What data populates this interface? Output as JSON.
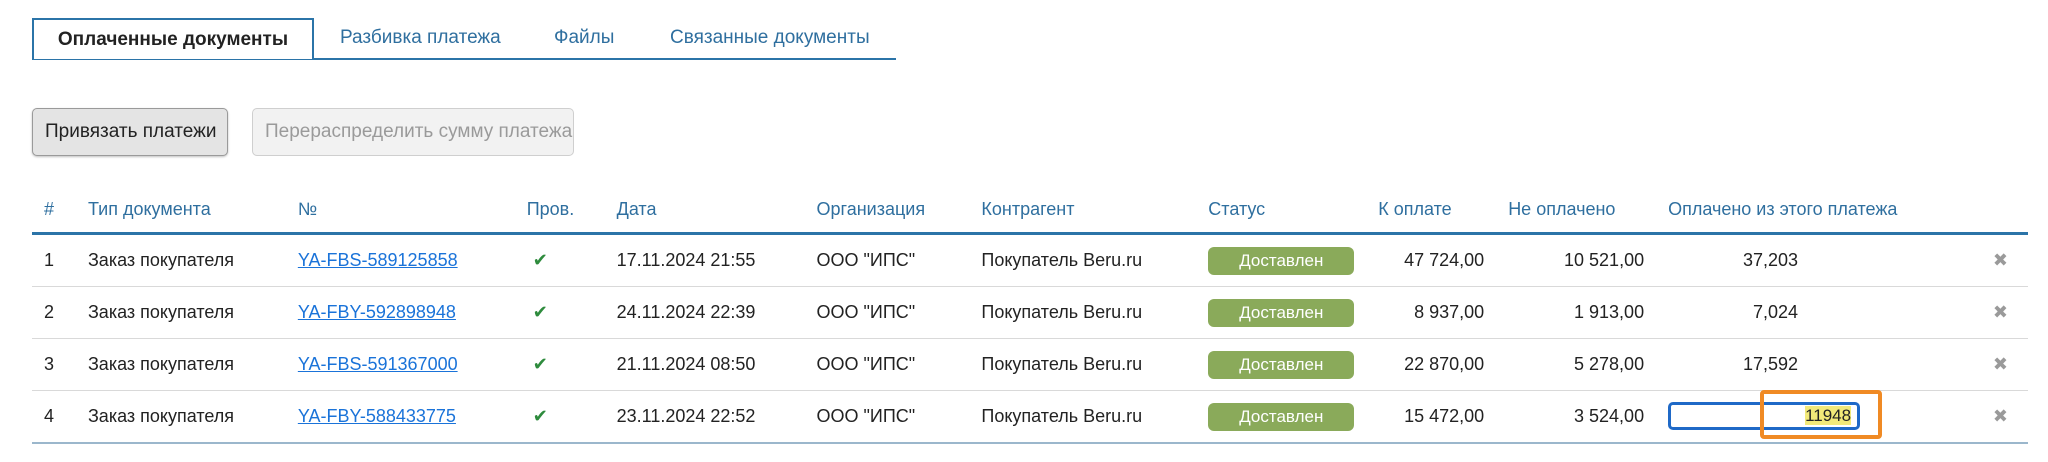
{
  "tabs": [
    {
      "label": "Оплаченные документы",
      "active": true
    },
    {
      "label": "Разбивка платежа",
      "active": false
    },
    {
      "label": "Файлы",
      "active": false
    },
    {
      "label": "Связанные документы",
      "active": false
    }
  ],
  "buttons": {
    "bind_payments": "Привязать платежи",
    "redistribute": "Перераспределить сумму платежа"
  },
  "table": {
    "headers": [
      "#",
      "Тип документа",
      "№",
      "Пров.",
      "Дата",
      "Организация",
      "Контрагент",
      "Статус",
      "К оплате",
      "Не оплачено",
      "Оплачено из этого платежа"
    ],
    "rows": [
      {
        "num": "1",
        "type": "Заказ покупателя",
        "doc": "YA-FBS-589125858",
        "posted": "✔",
        "date": "17.11.2024 21:55",
        "org": "ООО \"ИПС\"",
        "agent": "Покупатель Beru.ru",
        "status": "Доставлен",
        "to_pay": "47 724,00",
        "unpaid": "10 521,00",
        "paid": "37,203",
        "delete": "✖"
      },
      {
        "num": "2",
        "type": "Заказ покупателя",
        "doc": "YA-FBY-592898948",
        "posted": "✔",
        "date": "24.11.2024 22:39",
        "org": "ООО \"ИПС\"",
        "agent": "Покупатель Beru.ru",
        "status": "Доставлен",
        "to_pay": "8 937,00",
        "unpaid": "1 913,00",
        "paid": "7,024",
        "delete": "✖"
      },
      {
        "num": "3",
        "type": "Заказ покупателя",
        "doc": "YA-FBS-591367000",
        "posted": "✔",
        "date": "21.11.2024 08:50",
        "org": "ООО \"ИПС\"",
        "agent": "Покупатель Beru.ru",
        "status": "Доставлен",
        "to_pay": "22 870,00",
        "unpaid": "5 278,00",
        "paid": "17,592",
        "delete": "✖"
      },
      {
        "num": "4",
        "type": "Заказ покупателя",
        "doc": "YA-FBY-588433775",
        "posted": "✔",
        "date": "23.11.2024 22:52",
        "org": "ООО \"ИПС\"",
        "agent": "Покупатель Beru.ru",
        "status": "Доставлен",
        "to_pay": "15 472,00",
        "unpaid": "3 524,00",
        "paid_input": "11948",
        "delete": "✖"
      }
    ]
  },
  "colors": {
    "accent": "#2b74a8",
    "link": "#1a73d9",
    "status_badge": "#8aaa5a",
    "check": "#2e8b3d",
    "focus": "#f08a24",
    "selection": "#f2e979"
  }
}
